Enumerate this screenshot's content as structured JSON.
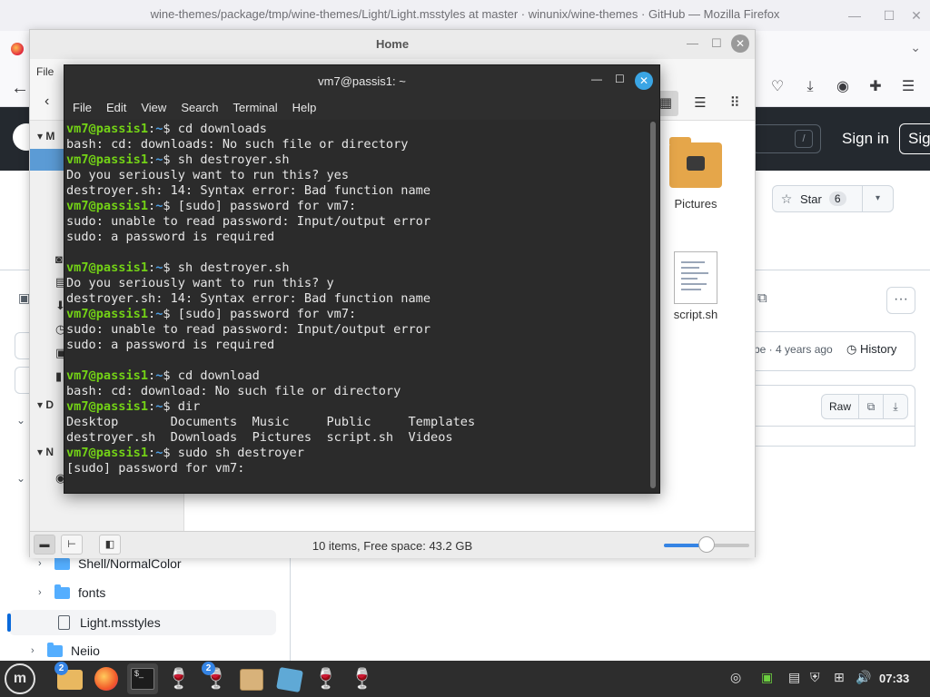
{
  "firefox": {
    "window_title": "wine-themes/package/tmp/wine-themes/Light/Light.msstyles at master · winunix/wine-themes · GitHub — Mozilla Firefox",
    "minimize": "—",
    "maximize": "☐",
    "close": "✕",
    "tab_overflow": "⌄",
    "toolbar_icons": [
      "pocket-icon",
      "download-icon",
      "account-icon",
      "extensions-icon",
      "menu-icon"
    ]
  },
  "github": {
    "search_slash": "/",
    "sign_in": "Sign in",
    "sign_up": "Sig",
    "star_label": "Star",
    "star_count": "6",
    "commit_age": "be · 4 years ago",
    "history": "History",
    "raw": "Raw",
    "tree": [
      {
        "label": "Shell/NormalColor",
        "type": "folder"
      },
      {
        "label": "fonts",
        "type": "folder"
      },
      {
        "label": "Light.msstyles",
        "type": "file",
        "selected": true
      },
      {
        "label": "Neiio",
        "type": "folder"
      }
    ]
  },
  "file_manager": {
    "title": "Home",
    "menu_file": "File",
    "items": [
      {
        "label": "Pictures",
        "icon": "pictures-folder-icon"
      },
      {
        "label": "script.sh",
        "icon": "script-file-icon"
      }
    ],
    "sidebar_headers": [
      "M",
      "D",
      "N"
    ],
    "status": "10 items, Free space: 43.2 GB",
    "zoom_level": 0.5
  },
  "terminal": {
    "title": "vm7@passis1: ~",
    "menu": [
      "File",
      "Edit",
      "View",
      "Search",
      "Terminal",
      "Help"
    ],
    "prompt_user": "vm7@passis1",
    "prompt_path": "~",
    "lines": [
      {
        "prompt": true,
        "text": "cd downloads"
      },
      {
        "prompt": false,
        "text": "bash: cd: downloads: No such file or directory"
      },
      {
        "prompt": true,
        "text": "sh destroyer.sh"
      },
      {
        "prompt": false,
        "text": "Do you seriously want to run this? yes"
      },
      {
        "prompt": false,
        "text": "destroyer.sh: 14: Syntax error: Bad function name"
      },
      {
        "prompt": true,
        "text": "[sudo] password for vm7:"
      },
      {
        "prompt": false,
        "text": "sudo: unable to read password: Input/output error"
      },
      {
        "prompt": false,
        "text": "sudo: a password is required"
      },
      {
        "prompt": false,
        "text": ""
      },
      {
        "prompt": true,
        "text": "sh destroyer.sh"
      },
      {
        "prompt": false,
        "text": "Do you seriously want to run this? y"
      },
      {
        "prompt": false,
        "text": "destroyer.sh: 14: Syntax error: Bad function name"
      },
      {
        "prompt": true,
        "text": "[sudo] password for vm7:"
      },
      {
        "prompt": false,
        "text": "sudo: unable to read password: Input/output error"
      },
      {
        "prompt": false,
        "text": "sudo: a password is required"
      },
      {
        "prompt": false,
        "text": ""
      },
      {
        "prompt": true,
        "text": "cd download"
      },
      {
        "prompt": false,
        "text": "bash: cd: download: No such file or directory"
      },
      {
        "prompt": true,
        "text": "dir"
      },
      {
        "prompt": false,
        "text": "Desktop       Documents  Music     Public     Templates"
      },
      {
        "prompt": false,
        "text": "destroyer.sh  Downloads  Pictures  script.sh  Videos"
      },
      {
        "prompt": true,
        "text": "sudo sh destroyer"
      },
      {
        "prompt": false,
        "text": "[sudo] password for vm7:"
      }
    ]
  },
  "taskbar": {
    "apps": [
      {
        "name": "files",
        "badge": "2"
      },
      {
        "name": "firefox",
        "badge": ""
      },
      {
        "name": "terminal",
        "badge": ""
      },
      {
        "name": "wine-glasses",
        "badge": ""
      },
      {
        "name": "wine-glass",
        "badge": "2"
      },
      {
        "name": "archive",
        "badge": ""
      },
      {
        "name": "virtualbox",
        "badge": ""
      },
      {
        "name": "wine-glass-2",
        "badge": ""
      },
      {
        "name": "wine-glass-3",
        "badge": ""
      }
    ],
    "clock": "07:33",
    "menu_glyph": "m"
  },
  "colors": {
    "prompt_user": "#73d216",
    "prompt_path": "#4e9fe4",
    "terminal_bg": "#2b2b2b",
    "accent": "#3584e4",
    "github_header": "#24292f"
  }
}
